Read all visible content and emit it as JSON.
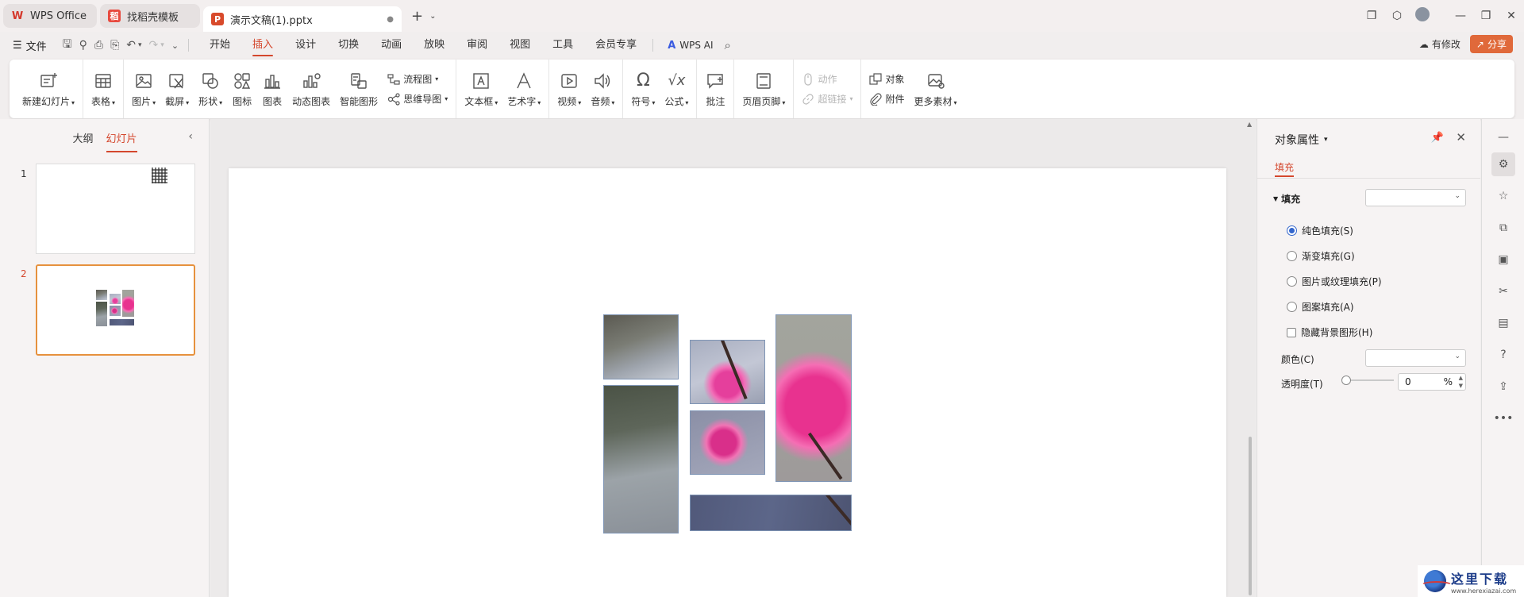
{
  "tabs": [
    {
      "label": "WPS Office",
      "icon": "wps-logo",
      "color": "#d4372b"
    },
    {
      "label": "找稻壳模板",
      "icon": "docer-logo",
      "color": "#e84a3f"
    },
    {
      "label": "演示文稿(1).pptx",
      "icon": "pptx-logo",
      "color": "#d84a2b",
      "active": true
    }
  ],
  "menu": {
    "file": "文件",
    "tabs": [
      "开始",
      "插入",
      "设计",
      "切换",
      "动画",
      "放映",
      "审阅",
      "视图",
      "工具",
      "会员专享"
    ],
    "active_tab": "插入",
    "wps_ai": "WPS AI",
    "modified": "有修改",
    "share": "分享"
  },
  "ribbon": {
    "new_slide": "新建幻灯片",
    "table": "表格",
    "picture": "图片",
    "screenshot": "截屏",
    "shape": "形状",
    "icon": "图标",
    "chart": "图表",
    "dynamic_chart": "动态图表",
    "smart_art": "智能图形",
    "flowchart": "流程图",
    "mindmap": "思维导图",
    "textbox": "文本框",
    "wordart": "艺术字",
    "video": "视频",
    "audio": "音频",
    "symbol": "符号",
    "formula": "公式",
    "comment": "批注",
    "header_footer": "页眉页脚",
    "action": "动作",
    "hyperlink": "超链接",
    "object": "对象",
    "attachment": "附件",
    "more_material": "更多素材"
  },
  "leftpanel": {
    "outline_tab": "大纲",
    "slides_tab": "幻灯片",
    "slides": [
      {
        "num": "1"
      },
      {
        "num": "2",
        "active": true
      }
    ]
  },
  "rightpanel": {
    "title": "对象属性",
    "subtab": "填充",
    "section": "填充",
    "options": [
      "纯色填充(S)",
      "渐变填充(G)",
      "图片或纹理填充(P)",
      "图案填充(A)"
    ],
    "selected_option": "纯色填充(S)",
    "hide_bg": "隐藏背景图形(H)",
    "color_label": "颜色(C)",
    "transparency_label": "透明度(T)",
    "transparency_value": "0",
    "transparency_unit": "%"
  },
  "watermark": {
    "title": "这里下载",
    "url": "www.herexiazai.com"
  },
  "colors": {
    "accent": "#d4472d",
    "share_bg": "#e0693a",
    "selection": "#e6913d"
  }
}
